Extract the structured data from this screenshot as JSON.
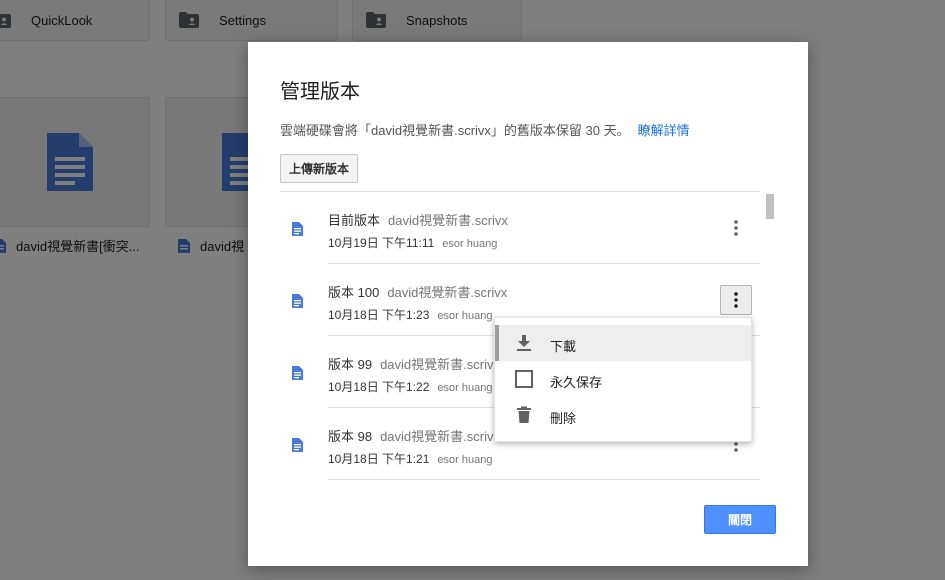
{
  "background": {
    "folders": [
      {
        "name": "QuickLook"
      },
      {
        "name": "Settings"
      },
      {
        "name": "Snapshots"
      }
    ],
    "files": [
      {
        "name": "david視覺新書[衝突..."
      },
      {
        "name": "david視"
      }
    ]
  },
  "dialog": {
    "title": "管理版本",
    "description": "雲端硬碟會將「david視覺新書.scrivx」的舊版本保留 30 天。",
    "learn_more": "瞭解詳情",
    "upload_label": "上傳新版本",
    "close_label": "關閉",
    "versions": [
      {
        "label": "目前版本",
        "filename": "david視覺新書.scrivx",
        "date": "10月19日 下午11:11",
        "author": "esor huang"
      },
      {
        "label": "版本 100",
        "filename": "david視覺新書.scrivx",
        "date": "10月18日 下午1:23",
        "author": "esor huang"
      },
      {
        "label": "版本 99",
        "filename": "david視覺新書.scrivx",
        "date": "10月18日 下午1:22",
        "author": "esor huang"
      },
      {
        "label": "版本 98",
        "filename": "david視覺新書.scrivx",
        "date": "10月18日 下午1:21",
        "author": "esor huang"
      }
    ]
  },
  "context_menu": {
    "items": [
      {
        "label": "下載",
        "icon": "download-icon"
      },
      {
        "label": "永久保存",
        "icon": "checkbox-icon"
      },
      {
        "label": "刪除",
        "icon": "trash-icon"
      }
    ]
  },
  "colors": {
    "accent": "#4d90fe",
    "link": "#1a73e8",
    "doc_icon": "#4a7ad8"
  }
}
